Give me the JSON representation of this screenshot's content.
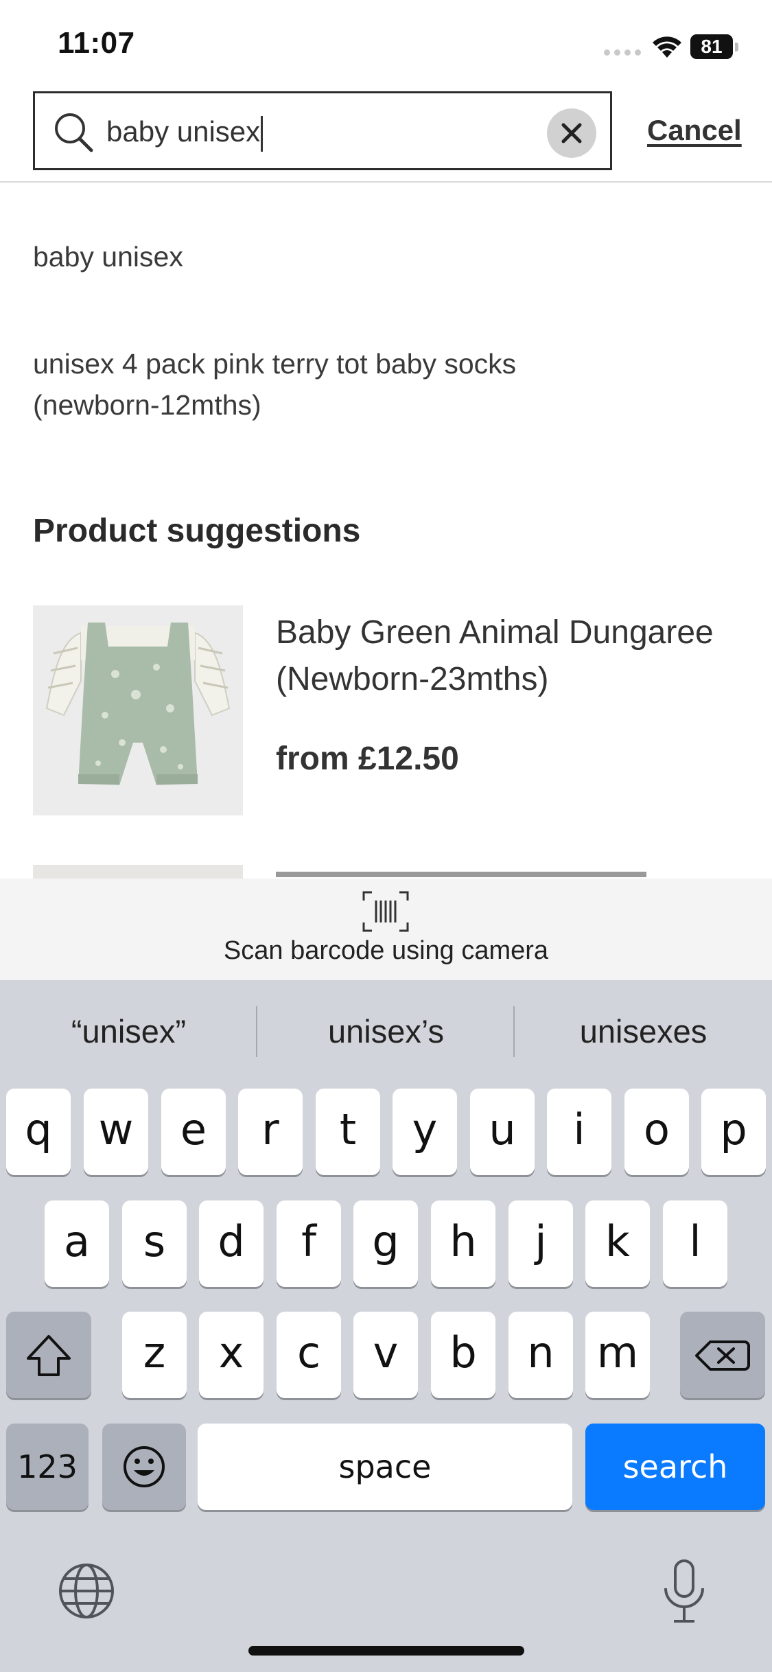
{
  "status_bar": {
    "time": "11:07",
    "battery": "81"
  },
  "search": {
    "query": "baby unisex",
    "cancel_label": "Cancel"
  },
  "suggestions": [
    "baby unisex",
    "unisex 4 pack pink terry tot baby socks (newborn-12mths)"
  ],
  "product_section": {
    "title": "Product suggestions",
    "products": [
      {
        "name": "Baby Green Animal Dungaree (Newborn-23mths)",
        "price": "from £12.50"
      }
    ]
  },
  "scan": {
    "label": "Scan barcode using camera"
  },
  "keyboard": {
    "predictions": [
      "“unisex”",
      "unisex’s",
      "unisexes"
    ],
    "row1": [
      "q",
      "w",
      "e",
      "r",
      "t",
      "y",
      "u",
      "i",
      "o",
      "p"
    ],
    "row2": [
      "a",
      "s",
      "d",
      "f",
      "g",
      "h",
      "j",
      "k",
      "l"
    ],
    "row3": [
      "z",
      "x",
      "c",
      "v",
      "b",
      "n",
      "m"
    ],
    "numbers_label": "123",
    "space_label": "space",
    "search_label": "search"
  }
}
